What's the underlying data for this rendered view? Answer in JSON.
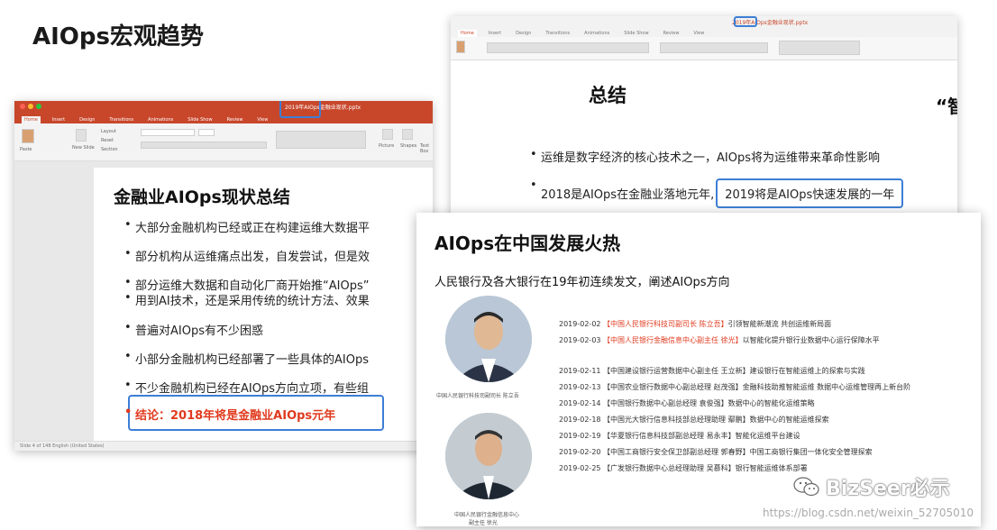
{
  "page": {
    "title": "AIOps宏观趋势"
  },
  "window_left": {
    "title": "2019年AIOps金融业现状.pptx",
    "tabs": [
      "Home",
      "Insert",
      "Design",
      "Transitions",
      "Animations",
      "Slide Show",
      "Review",
      "View"
    ],
    "ribbon": {
      "paste": "Paste",
      "new_slide": "New Slide",
      "layout": "Layout",
      "reset": "Reset",
      "section": "Section",
      "picture": "Picture",
      "shapes": "Shapes",
      "text_box": "Text Box"
    },
    "slide": {
      "title": "金融业AIOps现状总结",
      "bullets": [
        "大部分金融机构已经或正在构建运维大数据平",
        "部分机构从运维痛点出发，自发尝试，但是效",
        "部分运维大数据和自动化厂商开始推“AIOps”",
        "用到AI技术，还是采用传统的统计方法、效果",
        "普遍对AIOps有不少困惑",
        "小部分金融机构已经部署了一些具体的AIOps",
        "不少金融机构已经在AIOps方向立项，有些组"
      ],
      "conclusion": "结论：2018年将是金融业AIOps元年"
    },
    "status": "Slide 4 of 148    English (United States)"
  },
  "window_right": {
    "title": "2019年AIOps金融业现状.pptx",
    "tabs": [
      "Home",
      "Insert",
      "Design",
      "Transitions",
      "Animations",
      "Slide Show",
      "Review",
      "View"
    ],
    "slide": {
      "title": "总结",
      "quote": "“智",
      "bullet1": "运维是数字经济的核心技术之一，AIOps将为运维带来革命性影响",
      "bullet2_prefix": "2018是AIOps在金融业落地元年,",
      "bullet2_boxed": "2019将是AIOps快速发展的一年"
    }
  },
  "front_slide": {
    "title": "AIOps在中国发展火热",
    "subtitle": "人民银行及各大银行在19年初连续发文，阐述AIOps方向",
    "caption1": "中国人民银行科技司副司长 陈立吾",
    "caption2_line1": "中国人民银行金融信息中心",
    "caption2_line2": "副主任 徐光",
    "timeline": [
      {
        "date": "2019-02-02",
        "who": "【中国人民银行科技司副司长 陈立吾】",
        "what": "引领智能新潮流 共创运维新局面"
      },
      {
        "date": "2019-02-03",
        "who": "【中国人民银行金融信息中心副主任 徐光】",
        "what": "以智能化提升银行业数据中心运行保障水平"
      },
      {
        "date": "2019-02-11",
        "who": "【中国建设银行运营数据中心副主任 王立新】",
        "what": "建设银行在智能运维上的探索与实践"
      },
      {
        "date": "2019-02-13",
        "who": "【中国农业银行数据中心副总经理 赵茂强】",
        "what": "金融科技助推智能运维 数据中心运维管理再上新台阶"
      },
      {
        "date": "2019-02-14",
        "who": "【中国银行数据中心副总经理 袁俊强】",
        "what": "数据中心的智能化运维策略"
      },
      {
        "date": "2019-02-18",
        "who": "【中国光大银行信息科技部总经理助理 鄢鹏】",
        "what": "数据中心的智能运维探索"
      },
      {
        "date": "2019-02-19",
        "who": "【华夏银行信息科技部副总经理 易永丰】",
        "what": "智能化运维平台建设"
      },
      {
        "date": "2019-02-20",
        "who": "【中国工商银行安全保卫部副总经理 郭春野】",
        "what": "中国工商银行集团一体化安全管理探索"
      },
      {
        "date": "2019-02-25",
        "who": "【广发银行数据中心总经理助理 吴慕科】",
        "what": "银行智能运维体系部署"
      }
    ]
  },
  "watermark": {
    "brand": "BizSeer必示",
    "url": "https://blog.csdn.net/weixin_52705010"
  },
  "colors": {
    "ppt_red": "#c8472b",
    "highlight_blue": "#3d7fd6",
    "conclusion_red": "#e03a1e"
  }
}
